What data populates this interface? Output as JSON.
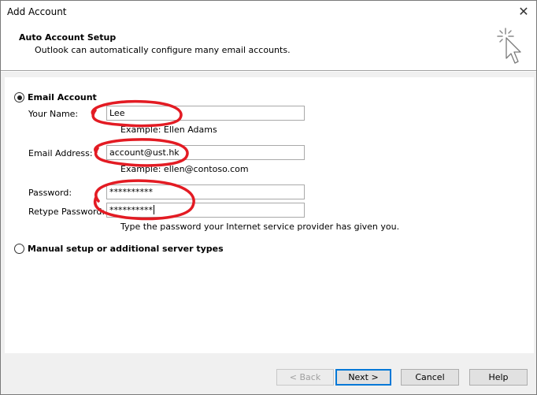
{
  "window": {
    "title": "Add Account",
    "close_glyph": "✕"
  },
  "header": {
    "title": "Auto Account Setup",
    "subtitle": "Outlook can automatically configure many email accounts.",
    "icon": "cursor-click-icon"
  },
  "email_account": {
    "label": "Email Account",
    "selected": true,
    "your_name": {
      "label": "Your Name:",
      "value": "Lee",
      "example": "Example: Ellen Adams"
    },
    "email_address": {
      "label": "Email Address:",
      "value": "account@ust.hk",
      "example": "Example: ellen@contoso.com"
    },
    "password": {
      "label": "Password:",
      "value": "**********"
    },
    "retype_password": {
      "label": "Retype Password:",
      "value": "**********"
    },
    "password_hint": "Type the password your Internet service provider has given you."
  },
  "manual_setup": {
    "label": "Manual setup or additional server types",
    "selected": false
  },
  "buttons": {
    "back": "< Back",
    "next": "Next >",
    "cancel": "Cancel",
    "help": "Help"
  },
  "colors": {
    "annotation": "#e31b23",
    "default_button_border": "#0078d7"
  }
}
